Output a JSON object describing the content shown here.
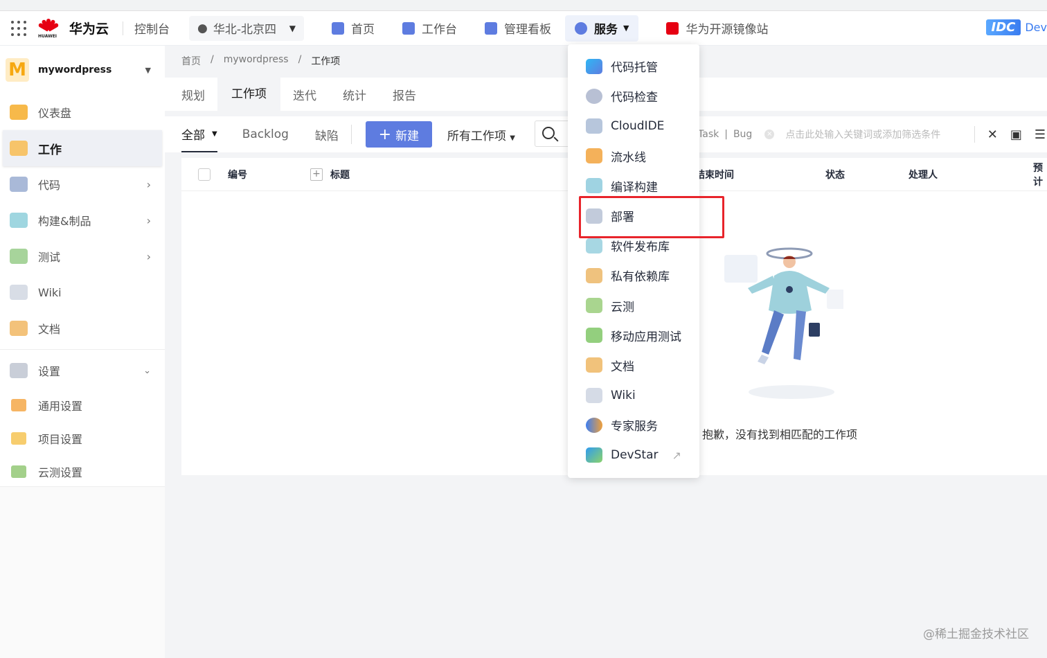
{
  "header": {
    "logo_text": "华为云",
    "logo_sub": "HUAWEI",
    "console": "控制台",
    "region": "华北-北京四",
    "nav": [
      {
        "label": "首页",
        "icon": "home-icon",
        "color": "#5e7ce0"
      },
      {
        "label": "工作台",
        "icon": "workbench-icon",
        "color": "#5e7ce0"
      },
      {
        "label": "管理看板",
        "icon": "dashboard-icon",
        "color": "#5e7ce0"
      },
      {
        "label": "服务",
        "icon": "service-icon",
        "color": "#5e7ce0"
      },
      {
        "label": "华为开源镜像站",
        "icon": "mirror-icon",
        "color": "#e60012"
      }
    ],
    "idc_badge": "IDC",
    "dev_text": "Dev"
  },
  "sidebar": {
    "project_initial": "M",
    "project_name": "mywordpress",
    "items": [
      {
        "label": "仪表盘",
        "icon": "dashboard-icon"
      },
      {
        "label": "工作",
        "icon": "work-icon"
      },
      {
        "label": "代码",
        "icon": "code-icon"
      },
      {
        "label": "构建&制品",
        "icon": "build-icon"
      },
      {
        "label": "测试",
        "icon": "test-icon"
      },
      {
        "label": "Wiki",
        "icon": "wiki-icon"
      },
      {
        "label": "文档",
        "icon": "doc-icon"
      },
      {
        "label": "设置",
        "icon": "settings-icon"
      }
    ],
    "sub_items": [
      {
        "label": "通用设置",
        "icon": "general-settings-icon"
      },
      {
        "label": "项目设置",
        "icon": "project-settings-icon"
      },
      {
        "label": "云测设置",
        "icon": "cloudtest-settings-icon"
      }
    ]
  },
  "breadcrumb": [
    "首页",
    "/",
    "mywordpress",
    "/",
    "工作项"
  ],
  "tabs": [
    "规划",
    "工作项",
    "迭代",
    "统计",
    "报告"
  ],
  "filter": {
    "all": "全部",
    "backlog": "Backlog",
    "defect": "缺陷",
    "new_button": "新建",
    "all_work_items": "所有工作项",
    "chip_task": "Task",
    "chip_sep": "|",
    "chip_bug": "Bug",
    "placeholder": "点击此处输入关键词或添加筛选条件"
  },
  "table": {
    "columns": [
      "编号",
      "标题",
      "结束时间",
      "状态",
      "处理人",
      "预计"
    ]
  },
  "empty_message": "抱歉，没有找到相匹配的工作项",
  "menu": {
    "items": [
      {
        "label": "代码托管",
        "icon": "code-hosting-icon"
      },
      {
        "label": "代码检查",
        "icon": "code-check-icon"
      },
      {
        "label": "CloudIDE",
        "icon": "cloudide-icon"
      },
      {
        "label": "流水线",
        "icon": "pipeline-icon"
      },
      {
        "label": "编译构建",
        "icon": "compile-build-icon"
      },
      {
        "label": "部署",
        "icon": "deploy-icon"
      },
      {
        "label": "软件发布库",
        "icon": "release-repo-icon"
      },
      {
        "label": "私有依赖库",
        "icon": "private-dependency-icon"
      },
      {
        "label": "云测",
        "icon": "cloudtest-icon"
      },
      {
        "label": "移动应用测试",
        "icon": "mobile-test-icon"
      },
      {
        "label": "文档",
        "icon": "doc-icon"
      },
      {
        "label": "Wiki",
        "icon": "wiki-icon"
      },
      {
        "label": "专家服务",
        "icon": "expert-icon"
      },
      {
        "label": "DevStar",
        "icon": "devstar-icon"
      }
    ]
  },
  "watermark": "@稀土掘金技术社区",
  "colors": {
    "accent": "#5e7ce0",
    "highlight": "#e8242b",
    "brand": "#e60012"
  }
}
